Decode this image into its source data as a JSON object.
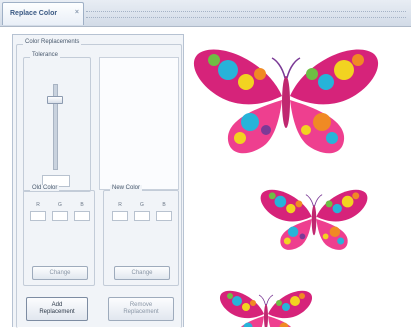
{
  "tab": {
    "title": "Replace Color",
    "close_glyph": "×"
  },
  "color_replacements": {
    "title": "Color Replacements",
    "tolerance": {
      "title": "Tolerance"
    },
    "old_color": {
      "title": "Old Color",
      "labels": [
        "R",
        "G",
        "B"
      ],
      "change_label": "Change"
    },
    "new_color": {
      "title": "New Color",
      "labels": [
        "R",
        "G",
        "B"
      ],
      "change_label": "Change"
    },
    "add_button": {
      "line1": "Add",
      "line2": "Replacement"
    },
    "remove_button": {
      "line1": "Remove",
      "line2": "Replacement"
    }
  },
  "colors": {
    "magenta": "#d6237a",
    "pink": "#ee3f8f",
    "cyan": "#27b3d9",
    "yellow": "#f2d321",
    "orange": "#f08a24",
    "green": "#6ebd44",
    "purple": "#7b3a96",
    "body": "#c02870"
  }
}
